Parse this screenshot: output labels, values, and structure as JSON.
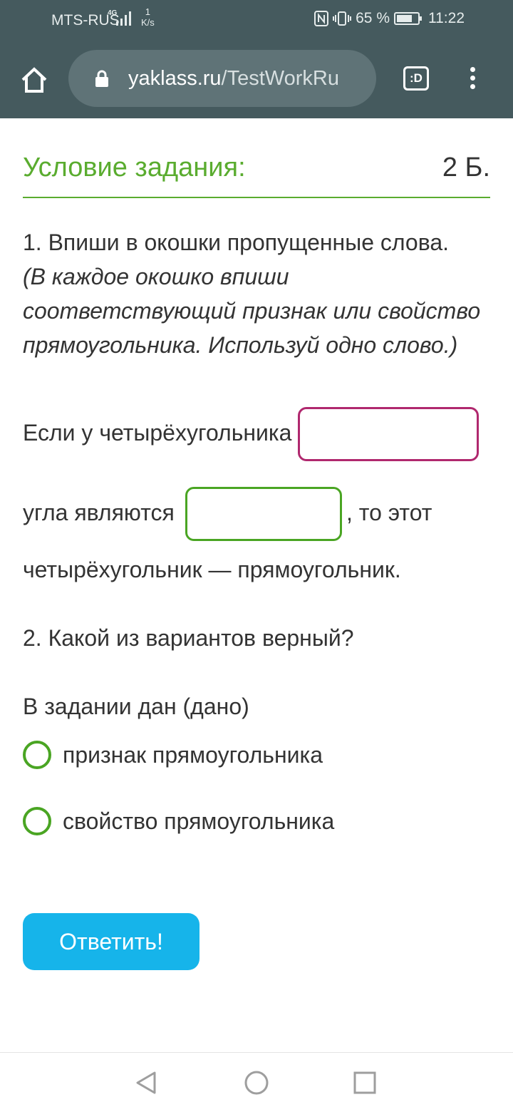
{
  "status_bar": {
    "carrier": "MTS-RUS",
    "network": "4G",
    "speed_value": "1",
    "speed_unit": "K/s",
    "battery": "65 %",
    "battery_level": 0.65,
    "time": "11:22"
  },
  "browser": {
    "url_domain": "yaklass.ru",
    "url_path": "/TestWorkRu",
    "tabs_label": ":D"
  },
  "task": {
    "title": "Условие задания:",
    "points": "2 Б."
  },
  "question1": {
    "prompt": "1. Впиши в окошки пропущенные слова.",
    "hint": "(В каждое окошко впиши соответствующий признак или свойство прямоугольника. Используй одно слово.)",
    "sentence_part1": "Если у четырёхугольника",
    "sentence_part2": "угла являются",
    "sentence_part3": ", то этот",
    "sentence_part4": "четырёхугольник — прямоугольник.",
    "blank1_value": "",
    "blank2_value": ""
  },
  "question2": {
    "prompt": "2. Какой из вариантов верный?",
    "lead": "В задании дан (дано)",
    "options": [
      "признак прямоугольника",
      "свойство прямоугольника"
    ]
  },
  "submit_label": "Ответить!",
  "colors": {
    "accent_green": "#5aac2f",
    "blank_pink": "#b0286e",
    "button_blue": "#16b4ea",
    "toolbar": "#455a5e"
  }
}
